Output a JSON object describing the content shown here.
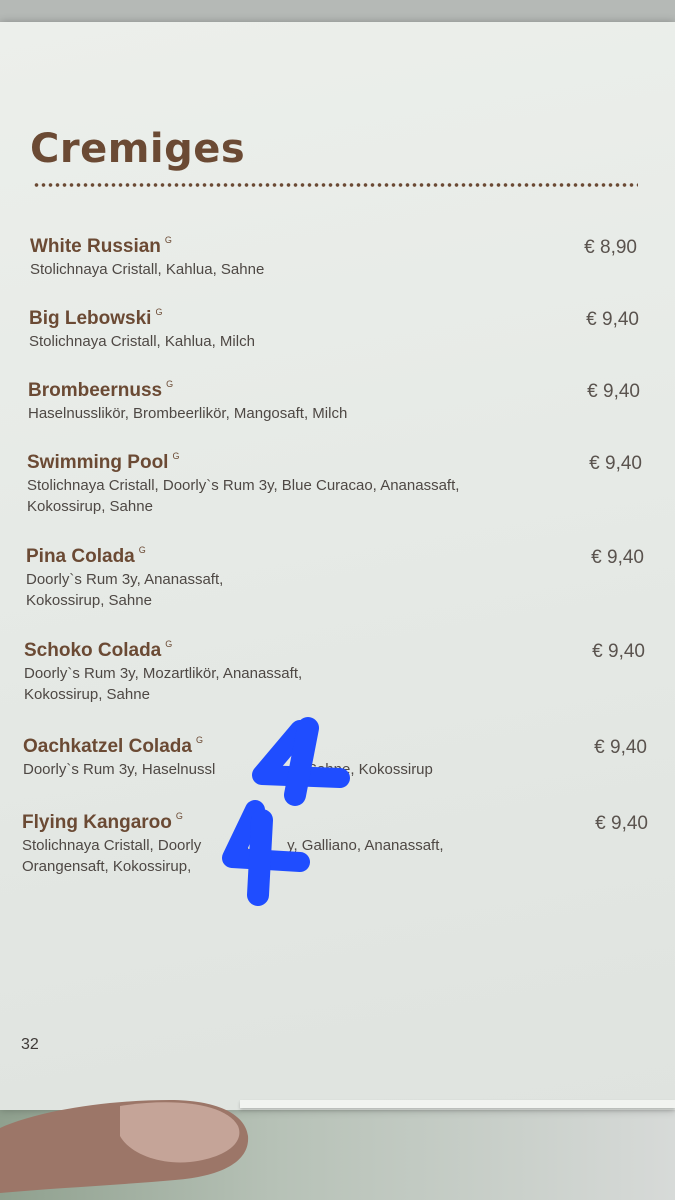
{
  "section": {
    "title": "Cremiges"
  },
  "items": [
    {
      "name": "White Russian",
      "badge": "G",
      "price": "€ 8,90",
      "desc": [
        "Stolichnaya Cristall, Kahlua, Sahne"
      ]
    },
    {
      "name": "Big Lebowski",
      "badge": "G",
      "price": "€ 9,40",
      "desc": [
        "Stolichnaya Cristall, Kahlua, Milch"
      ]
    },
    {
      "name": "Brombeernuss",
      "badge": "G",
      "price": "€ 9,40",
      "desc": [
        "Haselnusslikör, Brombeerlikör, Mangosaft, Milch"
      ]
    },
    {
      "name": "Swimming Pool",
      "badge": "G",
      "price": "€ 9,40",
      "desc": [
        "Stolichnaya Cristall, Doorly`s Rum 3y, Blue Curacao, Ananassaft,",
        "Kokossirup, Sahne"
      ]
    },
    {
      "name": "Pina Colada",
      "badge": "G",
      "price": "€ 9,40",
      "desc": [
        "Doorly`s Rum 3y, Ananassaft,",
        "Kokossirup, Sahne"
      ]
    },
    {
      "name": "Schoko Colada",
      "badge": "G",
      "price": "€ 9,40",
      "desc": [
        "Doorly`s Rum 3y, Mozartlikör, Ananassaft,",
        "Kokossirup, Sahne"
      ]
    },
    {
      "name": "Oachkatzel Colada",
      "badge": "G",
      "price": "€ 9,40",
      "desc": [
        "Doorly`s Rum 3y, Haselnussl                   t, Sahne, Kokossirup"
      ]
    },
    {
      "name": "Flying Kangaroo",
      "badge": "G",
      "price": "€ 9,40",
      "desc": [
        "Stolichnaya Cristall, Doorly        Rum     y, Galliano, Ananassaft,",
        "Orangensaft, Kokossirup,"
      ]
    }
  ],
  "page_number": "32",
  "annotations": {
    "handwritten_mark_1": "4",
    "handwritten_mark_2": "4",
    "marker_color": "#1f4dff"
  },
  "colors": {
    "heading": "#6b4a34",
    "body_text": "#4e4844",
    "paper": "#e8ebe7"
  }
}
